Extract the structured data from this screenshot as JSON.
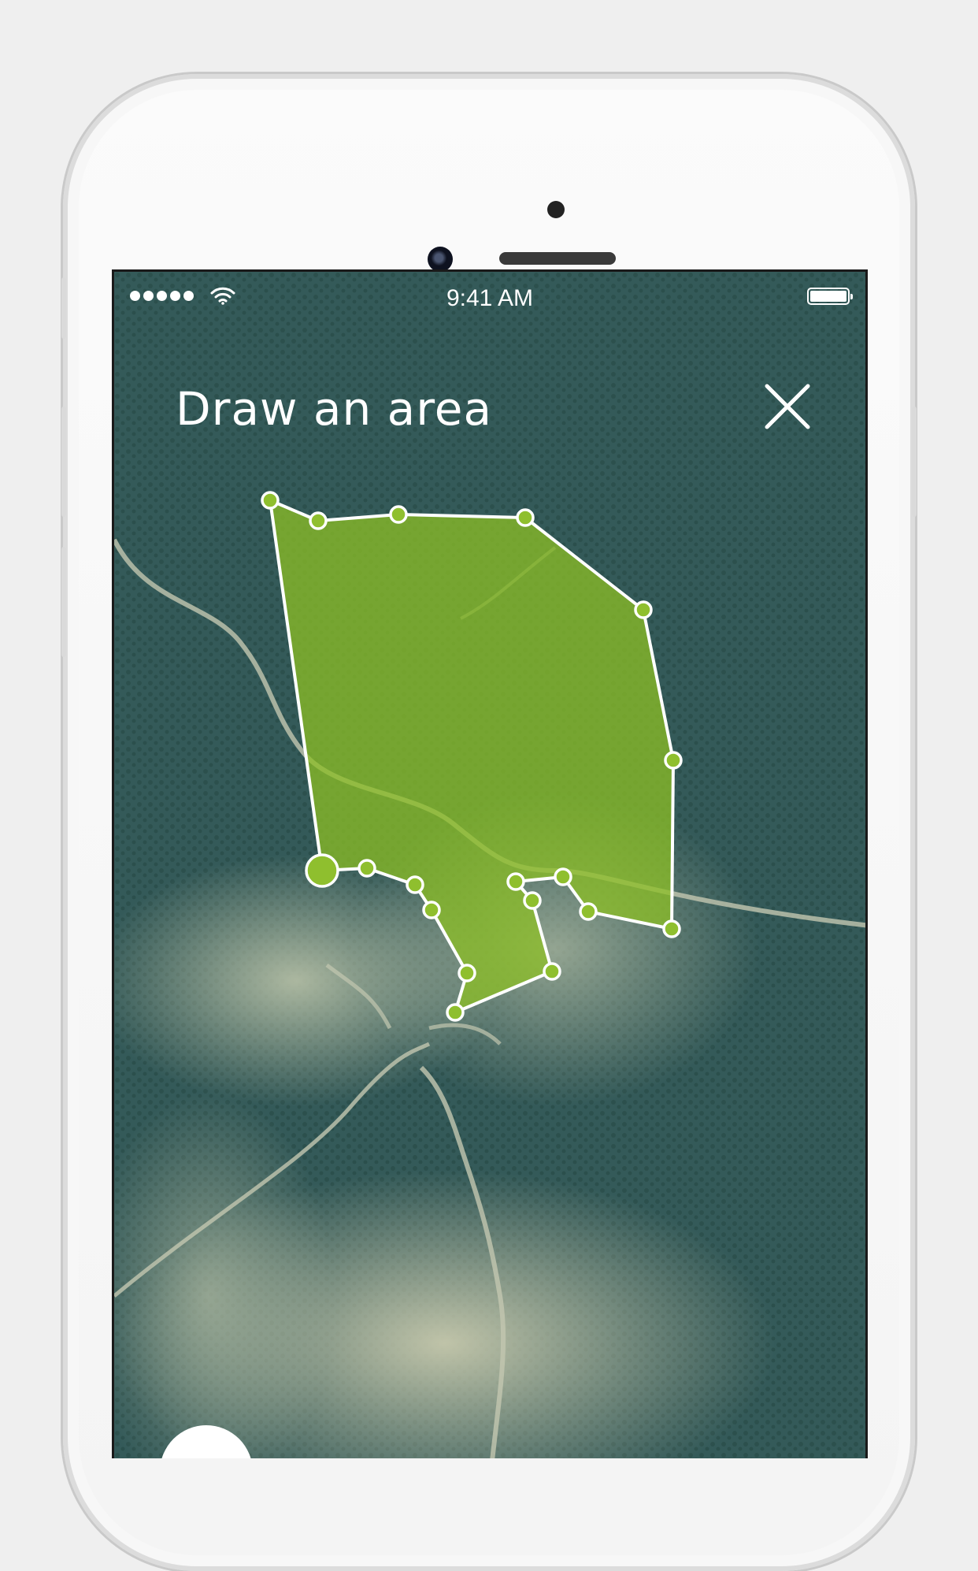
{
  "status_bar": {
    "time": "9:41 AM"
  },
  "header": {
    "title": "Draw an area"
  },
  "colors": {
    "polygon_fill": "#8cbf24",
    "vertex": "#8fbf2e",
    "stroke": "#ffffff"
  },
  "icons": {
    "close": "close-icon",
    "wifi": "wifi-icon",
    "battery": "battery-icon"
  }
}
